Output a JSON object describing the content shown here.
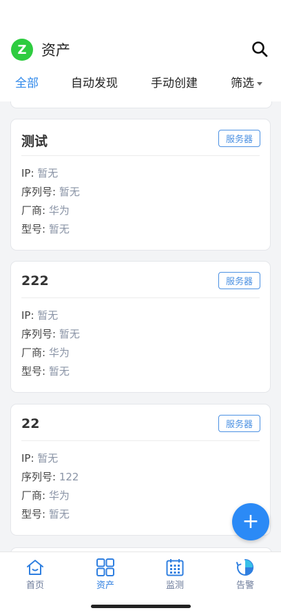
{
  "header": {
    "brand_letter": "Z",
    "title": "资产",
    "search_icon": "search-icon"
  },
  "tabs": [
    {
      "label": "全部",
      "active": true
    },
    {
      "label": "自动发现",
      "active": false
    },
    {
      "label": "手动创建",
      "active": false
    },
    {
      "label": "筛选",
      "active": false
    }
  ],
  "cards": [
    {
      "title": "测试",
      "tag": "服务器",
      "ip_label": "IP: ",
      "ip": "暂无",
      "serial_label": "序列号: ",
      "serial": "暂无",
      "vendor_label": "厂商: ",
      "vendor": "华为",
      "model_label": "型号: ",
      "model": "暂无"
    },
    {
      "title": "222",
      "tag": "服务器",
      "ip_label": "IP: ",
      "ip": "暂无",
      "serial_label": "序列号: ",
      "serial": "暂无",
      "vendor_label": "厂商: ",
      "vendor": "华为",
      "model_label": "型号: ",
      "model": "暂无"
    },
    {
      "title": "22",
      "tag": "服务器",
      "ip_label": "IP: ",
      "ip": "暂无",
      "serial_label": "序列号: ",
      "serial": "122",
      "vendor_label": "厂商: ",
      "vendor": "华为",
      "model_label": "型号: ",
      "model": "暂无"
    }
  ],
  "fab": {
    "label": "+"
  },
  "bottom_nav": [
    {
      "label": "首页",
      "icon": "home-icon",
      "active": false
    },
    {
      "label": "资产",
      "icon": "grid-icon",
      "active": true
    },
    {
      "label": "监测",
      "icon": "calendar-icon",
      "active": false
    },
    {
      "label": "告警",
      "icon": "clock-alert-icon",
      "active": false
    }
  ],
  "colors": {
    "accent": "#2f88ea",
    "brand": "#2ecc40",
    "tag": "#4a90e2",
    "value_text": "#8a94a6"
  }
}
